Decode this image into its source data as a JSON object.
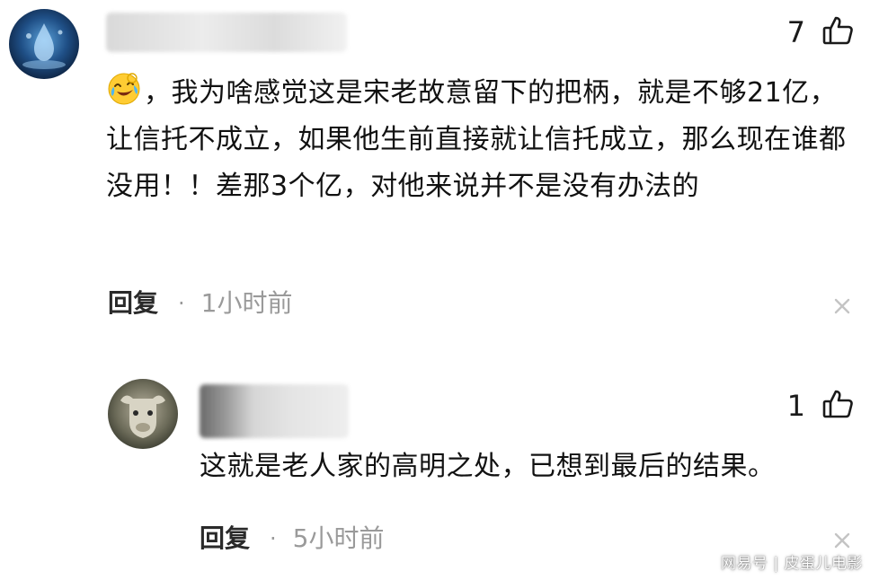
{
  "comments": [
    {
      "likes": "7",
      "text": "，我为啥感觉这是宋老故意留下的把柄，就是不够21亿，让信托不成立，如果他生前直接就让信托成立，那么现在谁都没用！！差那3个亿，对他来说并不是没有办法的",
      "reply_label": "回复",
      "separator": "·",
      "time": "1小时前",
      "emoji": "crying-laughing-emoji"
    },
    {
      "likes": "1",
      "text": "这就是老人家的高明之处，已想到最后的结果。",
      "reply_label": "回复",
      "separator": "·",
      "time": "5小时前"
    }
  ],
  "watermark": "网易号 | 皮蛋儿电影",
  "colors": {
    "text": "#111111",
    "muted": "#9a9a9a",
    "background": "#ffffff"
  },
  "icons": [
    "thumbs-up-icon",
    "close-icon",
    "user-avatar-water",
    "user-avatar-bull"
  ]
}
